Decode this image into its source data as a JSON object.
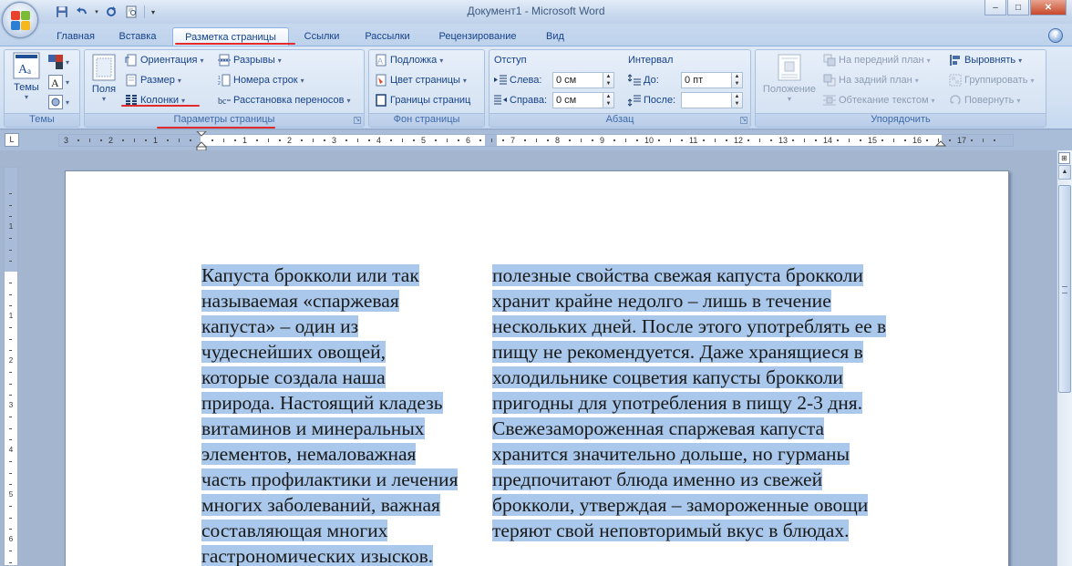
{
  "window": {
    "title": "Документ1 - Microsoft Word",
    "controls": [
      "–",
      "□",
      "✕"
    ]
  },
  "tabs": [
    {
      "label": "Главная",
      "active": false
    },
    {
      "label": "Вставка",
      "active": false
    },
    {
      "label": "Разметка страницы",
      "active": true
    },
    {
      "label": "Ссылки",
      "active": false
    },
    {
      "label": "Рассылки",
      "active": false
    },
    {
      "label": "Рецензирование",
      "active": false
    },
    {
      "label": "Вид",
      "active": false
    }
  ],
  "help": "?",
  "ribbon": {
    "themes": {
      "label": "Темы",
      "button": "Темы"
    },
    "page_setup": {
      "label": "Параметры страницы",
      "fields_button": "Поля",
      "orientation": "Ориентация",
      "size": "Размер",
      "columns": "Колонки",
      "breaks": "Разрывы",
      "line_numbers": "Номера строк",
      "hyphenation": "Расстановка переносов"
    },
    "page_background": {
      "label": "Фон страницы",
      "watermark": "Подложка",
      "page_color": "Цвет страницы",
      "page_borders": "Границы страниц"
    },
    "paragraph": {
      "label": "Абзац",
      "indent_heading": "Отступ",
      "left_label": "Слева:",
      "left_value": "0 см",
      "right_label": "Справа:",
      "right_value": "0 см",
      "spacing_heading": "Интервал",
      "before_label": "До:",
      "before_value": "0 пт",
      "after_label": "После:",
      "after_value": ""
    },
    "arrange": {
      "label": "Упорядочить",
      "position": "Положение",
      "bring_front": "На передний план",
      "send_back": "На задний план",
      "text_wrap": "Обтекание текстом",
      "align": "Выровнять",
      "group": "Группировать",
      "rotate": "Повернуть"
    }
  },
  "ruler": {
    "tab_selector": "L",
    "numbers": [
      "3",
      "2",
      "1",
      "1",
      "2",
      "3",
      "4",
      "5",
      "6",
      "7",
      "8",
      "9",
      "10",
      "11",
      "12",
      "13",
      "14",
      "15",
      "16",
      "17"
    ],
    "vertical_numbers": [
      "1",
      "1",
      "2",
      "3",
      "4",
      "5",
      "6"
    ]
  },
  "document": {
    "column1": [
      "Капуста брокколи или так",
      "называемая «спаржевая",
      "капуста» – один из",
      "чудеснейших овощей,",
      "которые создала наша",
      "природа. Настоящий кладезь",
      "витаминов и минеральных",
      "элементов, немаловажная",
      "часть профилактики и лечения",
      "многих заболеваний, важная",
      "составляющая многих",
      "гастрономических изысков."
    ],
    "column2": [
      "полезные свойства свежая капуста брокколи",
      "хранит крайне недолго – лишь в течение",
      "нескольких дней. После этого употреблять ее в",
      "пищу не рекомендуется. Даже хранящиеся в",
      "холодильнике соцветия капусты брокколи",
      "пригодны для употребления в пищу 2-3 дня.",
      "Свежезамороженная спаржевая капуста",
      "хранится значительно дольше, но гурманы",
      "предпочитают блюда именно из свежей",
      "брокколи, утверждая – замороженные овощи",
      "теряют свой неповторимый вкус в блюдах."
    ]
  },
  "colors": {
    "selection": "#a9c8eb",
    "annotation_underline": "#e12a2a",
    "ribbon_text": "#15428b"
  }
}
